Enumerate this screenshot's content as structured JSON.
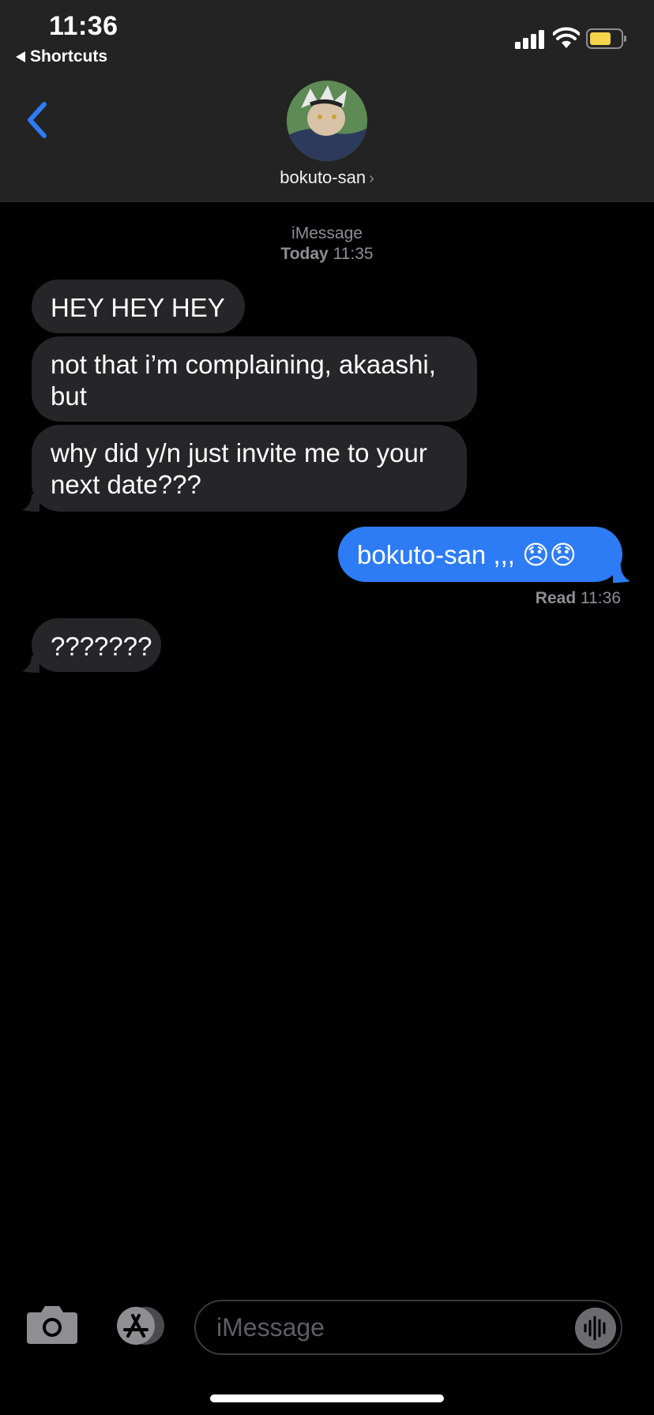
{
  "status_bar": {
    "time": "11:36",
    "back_app": "Shortcuts",
    "battery_color": "#f5d34a"
  },
  "header": {
    "contact_name": "bokuto-san",
    "name_chevron": "›",
    "back_icon": "chevron-left-icon",
    "accent": "#2d7cf6"
  },
  "thread": {
    "service_label": "iMessage",
    "timestamp_day": "Today",
    "timestamp_time": "11:35",
    "messages": [
      {
        "direction": "incoming",
        "text": "HEY HEY HEY"
      },
      {
        "direction": "incoming",
        "text": "not that i’m complaining, akaashi, but"
      },
      {
        "direction": "incoming",
        "text": "why did y/n just invite me to your next date???"
      },
      {
        "direction": "outgoing",
        "text": "bokuto-san ,,, 😞😞"
      },
      {
        "direction": "incoming",
        "text": "???????"
      }
    ],
    "receipt_status": "Read",
    "receipt_time": "11:36"
  },
  "composer": {
    "placeholder": "iMessage",
    "camera_icon": "camera-icon",
    "apps_icon": "app-store-icon",
    "audio_icon": "waveform-icon"
  },
  "colors": {
    "incoming_bubble": "#262628",
    "outgoing_bubble": "#2d7cf6",
    "header_bg": "#232323"
  }
}
